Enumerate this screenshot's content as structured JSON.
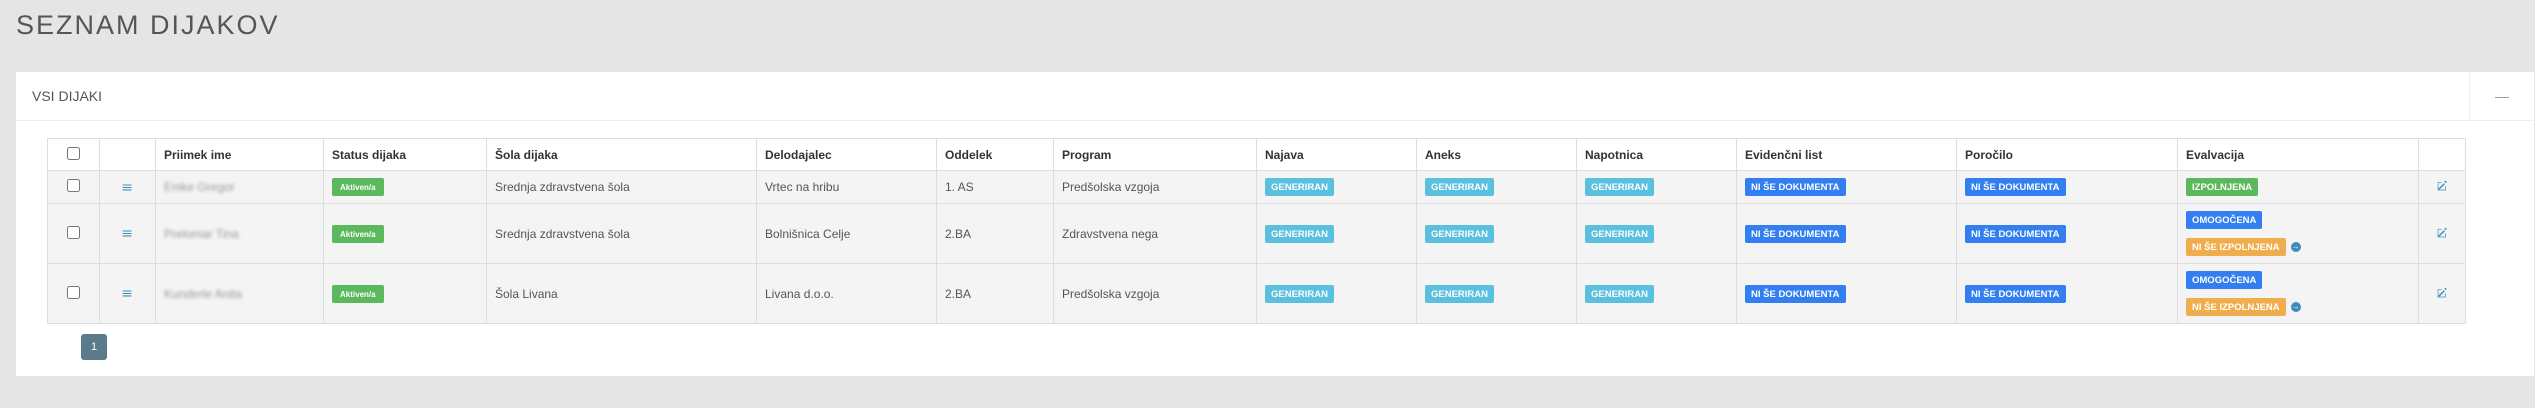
{
  "page": {
    "title": "SEZNAM DIJAKOV"
  },
  "panel": {
    "title": "VSI DIJAKI",
    "collapse_symbol": "—"
  },
  "table": {
    "headers": {
      "name": "Priimek ime",
      "status": "Status dijaka",
      "school": "Šola dijaka",
      "employer": "Delodajalec",
      "class": "Oddelek",
      "program": "Program",
      "najava": "Najava",
      "aneks": "Aneks",
      "napotnica": "Napotnica",
      "evidencni": "Evidenčni list",
      "porocilo": "Poročilo",
      "evalvacija": "Evalvacija"
    },
    "rows": [
      {
        "name": "Enike Gregor",
        "status": "Aktiven/a",
        "school": "Srednja zdravstvena šola",
        "employer": "Vrtec na hribu",
        "class": "1. AS",
        "program": "Predšolska vzgoja",
        "najava": "GENERIRAN",
        "aneks": "GENERIRAN",
        "napotnica": "GENERIRAN",
        "evidencni": "NI ŠE DOKUMENTA",
        "porocilo": "NI ŠE DOKUMENTA",
        "evalvacija": [
          "IZPOLNJENA"
        ]
      },
      {
        "name": "Prelomar Tina",
        "status": "Aktiven/a",
        "school": "Srednja zdravstvena šola",
        "employer": "Bolnišnica Celje",
        "class": "2.BA",
        "program": "Zdravstvena nega",
        "najava": "GENERIRAN",
        "aneks": "GENERIRAN",
        "napotnica": "GENERIRAN",
        "evidencni": "NI ŠE DOKUMENTA",
        "porocilo": "NI ŠE DOKUMENTA",
        "evalvacija": [
          "OMOGOČENA",
          "NI ŠE IZPOLNJENA"
        ]
      },
      {
        "name": "Kunderle Anita",
        "status": "Aktiven/a",
        "school": "Šola Livana",
        "employer": "Livana d.o.o.",
        "class": "2.BA",
        "program": "Predšolska vzgoja",
        "najava": "GENERIRAN",
        "aneks": "GENERIRAN",
        "napotnica": "GENERIRAN",
        "evidencni": "NI ŠE DOKUMENTA",
        "porocilo": "NI ŠE DOKUMENTA",
        "evalvacija": [
          "OMOGOČENA",
          "NI ŠE IZPOLNJENA"
        ]
      }
    ]
  },
  "pagination": {
    "current": "1"
  },
  "icons": {
    "expand": "chevron-double-down-icon",
    "edit": "edit-icon",
    "arrow": "arrow-circle-right-icon"
  },
  "colors": {
    "background": "#e5e5e5",
    "status_success": "#5cb85c",
    "info": "#5bc0de",
    "primary": "#337ef0",
    "warning": "#f0ad4e",
    "link": "#3c8dbc",
    "pagination": "#5b7b8d"
  }
}
